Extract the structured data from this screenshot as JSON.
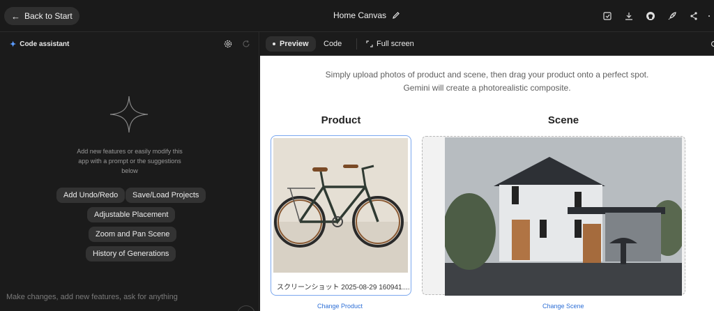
{
  "topbar": {
    "back_label": "Back to Start",
    "title": "Home Canvas",
    "icons": [
      "edit-icon",
      "save-icon",
      "download-icon",
      "github-icon",
      "deploy-icon",
      "share-icon"
    ]
  },
  "assistant": {
    "title": "Code assistant",
    "intro": "Add new features or easily modify this app with a prompt or the suggestions below",
    "suggestions": [
      "Add Undo/Redo",
      "Save/Load Projects",
      "Adjustable Placement",
      "Zoom and Pan Scene",
      "History of Generations"
    ],
    "prompt_placeholder": "Make changes, add new features, ask for anything"
  },
  "tabs": {
    "preview": "Preview",
    "code": "Code",
    "fullscreen": "Full screen"
  },
  "app": {
    "subtitle_line1": "Simply upload photos of product and scene, then drag your product onto a perfect spot.",
    "subtitle_line2": "Gemini will create a photorealistic composite.",
    "product_heading": "Product",
    "scene_heading": "Scene",
    "product_filename": "スクリーンショット 2025-08-29 160941....",
    "change_product": "Change Product",
    "change_scene": "Change Scene"
  },
  "colors": {
    "accent_blue": "#2d6fd6",
    "assistant_spark": "#5b9cff",
    "product_border": "#7aa7ee"
  }
}
